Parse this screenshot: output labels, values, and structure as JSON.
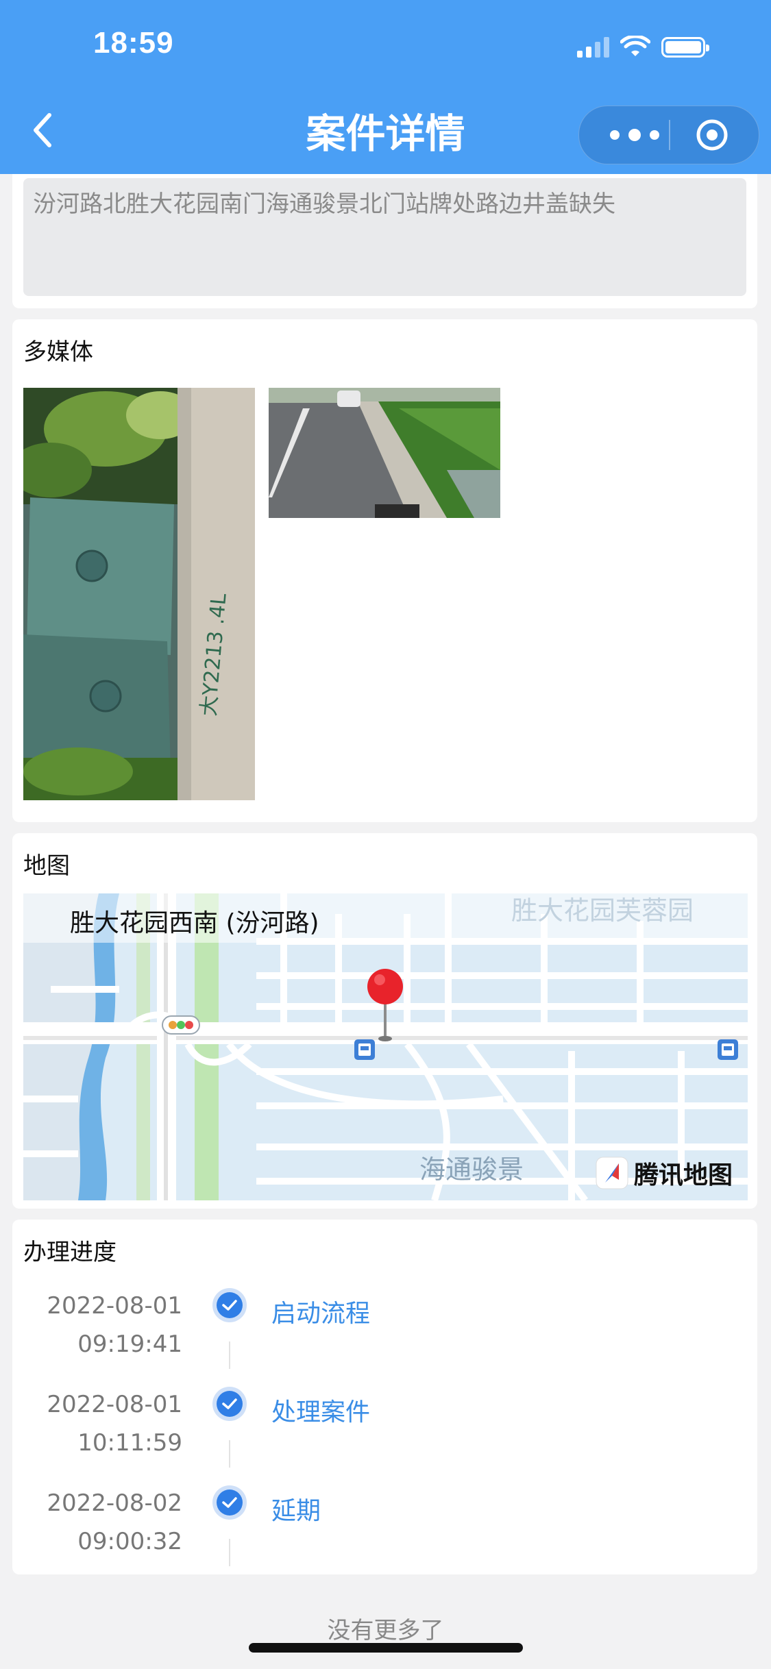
{
  "status_bar": {
    "time": "18:59"
  },
  "nav": {
    "title": "案件详情"
  },
  "description": {
    "text": "汾河路北胜大花园南门海通骏景北门站牌处路边井盖缺失"
  },
  "media": {
    "title": "多媒体"
  },
  "map": {
    "title": "地图",
    "location_label": "胜大花园西南 (汾河路)",
    "place_top": "胜大花园芙蓉园",
    "place_bottom": "海通骏景",
    "provider": "腾讯地图"
  },
  "progress": {
    "title": "办理进度",
    "steps": [
      {
        "date": "2022-08-01",
        "time": "09:19:41",
        "label": "启动流程"
      },
      {
        "date": "2022-08-01",
        "time": "10:11:59",
        "label": "处理案件"
      },
      {
        "date": "2022-08-02",
        "time": "09:00:32",
        "label": "延期"
      }
    ]
  },
  "footer": {
    "text": "没有更多了"
  },
  "colors": {
    "header": "#4a9ff5",
    "accent": "#3a8de6",
    "background": "#f2f2f3"
  }
}
